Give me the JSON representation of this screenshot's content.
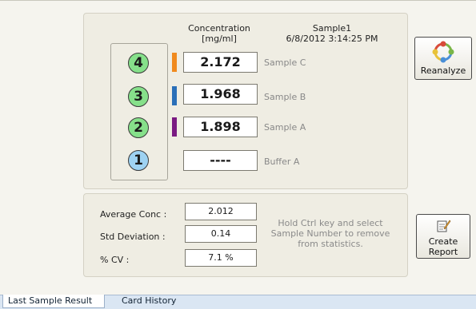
{
  "headers": {
    "concentration_line1": "Concentration",
    "concentration_line2": "[mg/ml]",
    "sample_line1": "Sample1",
    "sample_line2": "6/8/2012 3:14:25 PM"
  },
  "rows": [
    {
      "number": "4",
      "value": "2.172",
      "sample": "Sample C",
      "badge_color": "#86e08a",
      "bar_color": "#f08a1e"
    },
    {
      "number": "3",
      "value": "1.968",
      "sample": "Sample B",
      "badge_color": "#86e08a",
      "bar_color": "#2a6fb8"
    },
    {
      "number": "2",
      "value": "1.898",
      "sample": "Sample A",
      "badge_color": "#86e08a",
      "bar_color": "#7a1a82"
    },
    {
      "number": "1",
      "value": "----",
      "sample": "Buffer A",
      "badge_color": "#9ed2f2",
      "bar_color": ""
    }
  ],
  "stats": {
    "average_label": "Average Conc :",
    "average_value": "2.012",
    "std_label": "Std Deviation :",
    "std_value": "0.14",
    "cv_label": "% CV :",
    "cv_value": "7.1 %"
  },
  "hint": "Hold Ctrl key and select Sample Number to remove from statistics.",
  "buttons": {
    "reanalyze": "Reanalyze",
    "report_line1": "Create",
    "report_line2": "Report"
  },
  "tabs": [
    "Last Sample Result",
    "Card History"
  ]
}
